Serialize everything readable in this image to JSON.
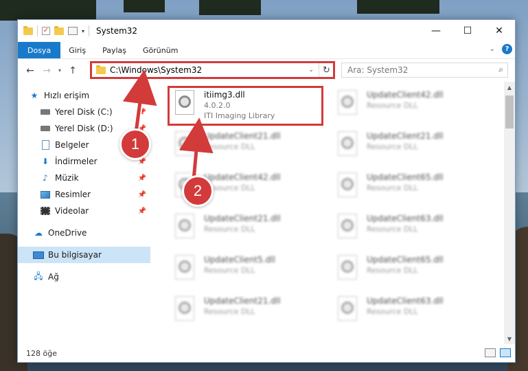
{
  "window": {
    "title": "System32",
    "controls": {
      "minimize": "—",
      "maximize": "☐",
      "close": "✕"
    }
  },
  "ribbon": {
    "tabs": [
      {
        "label": "Dosya",
        "active": true
      },
      {
        "label": "Giriş"
      },
      {
        "label": "Paylaş"
      },
      {
        "label": "Görünüm"
      }
    ],
    "help": "?"
  },
  "nav": {
    "address": "C:\\Windows\\System32",
    "search_placeholder": "Ara: System32"
  },
  "sidebar": {
    "items": [
      {
        "label": "Hızlı erişim",
        "icon": "star-icon"
      },
      {
        "label": "Yerel Disk (C:)",
        "icon": "disk-icon",
        "pinned": true
      },
      {
        "label": "Yerel Disk (D:)",
        "icon": "disk-icon",
        "pinned": true
      },
      {
        "label": "Belgeler",
        "icon": "document-icon"
      },
      {
        "label": "İndirmeler",
        "icon": "download-icon",
        "pinned": true
      },
      {
        "label": "Müzik",
        "icon": "music-icon",
        "pinned": true
      },
      {
        "label": "Resimler",
        "icon": "pictures-icon",
        "pinned": true
      },
      {
        "label": "Videolar",
        "icon": "videos-icon",
        "pinned": true
      },
      {
        "label": "OneDrive",
        "icon": "cloud-icon"
      },
      {
        "label": "Bu bilgisayar",
        "icon": "pc-icon",
        "selected": true
      },
      {
        "label": "Ağ",
        "icon": "network-icon"
      }
    ]
  },
  "files": {
    "highlighted": {
      "name": "itiimg3.dll",
      "version": "4.0.2.0",
      "description": "ITI Imaging Library"
    },
    "items": [
      {
        "name": "UpdateClient42.dll",
        "type": "Resource DLL"
      },
      {
        "name": "UpdateClient21.dll",
        "type": "Resource DLL"
      },
      {
        "name": "UpdateClient21.dll",
        "type": "Resource DLL"
      },
      {
        "name": "UpdateClient42.dll",
        "type": "Resource DLL"
      },
      {
        "name": "UpdateClient65.dll",
        "type": "Resource DLL"
      },
      {
        "name": "UpdateClient21.dll",
        "type": "Resource DLL"
      },
      {
        "name": "UpdateClient63.dll",
        "type": "Resource DLL"
      },
      {
        "name": "UpdateClient5.dll",
        "type": "Resource DLL"
      },
      {
        "name": "UpdateClient65.dll",
        "type": "Resource DLL"
      },
      {
        "name": "UpdateClient21.dll",
        "type": "Resource DLL"
      },
      {
        "name": "UpdateClient63.dll",
        "type": "Resource DLL"
      }
    ]
  },
  "status": {
    "count": "128 öğe"
  },
  "callouts": {
    "one": "1",
    "two": "2"
  },
  "colors": {
    "accent": "#1979ca",
    "highlight": "#d33a3a",
    "selected": "#cce4f7"
  }
}
